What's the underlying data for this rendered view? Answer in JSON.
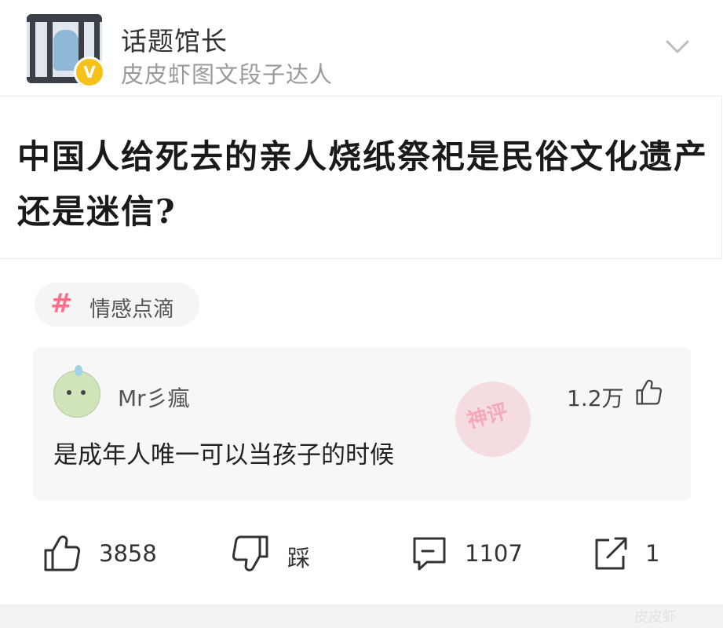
{
  "author": {
    "name": "话题馆长",
    "description": "皮皮虾图文段子达人",
    "badge": "V"
  },
  "post": {
    "title": "中国人给死去的亲人烧纸祭祀是民俗文化遗产还是迷信?"
  },
  "tag": {
    "symbol": "#",
    "label": "情感点滴",
    "color": "#ff6d8a"
  },
  "god_comment": {
    "username": "Mr彡瘋",
    "likes": "1.2万",
    "text": "是成年人唯一可以当孩子的时候",
    "stamp": "神评"
  },
  "actions": {
    "like_count": "3858",
    "dislike_label": "踩",
    "comment_count": "1107",
    "share_count": "1"
  },
  "watermark": "皮皮虾",
  "icons": [
    "chevron-down-icon",
    "thumbs-up-icon",
    "thumbs-down-icon",
    "comment-icon",
    "share-icon"
  ]
}
